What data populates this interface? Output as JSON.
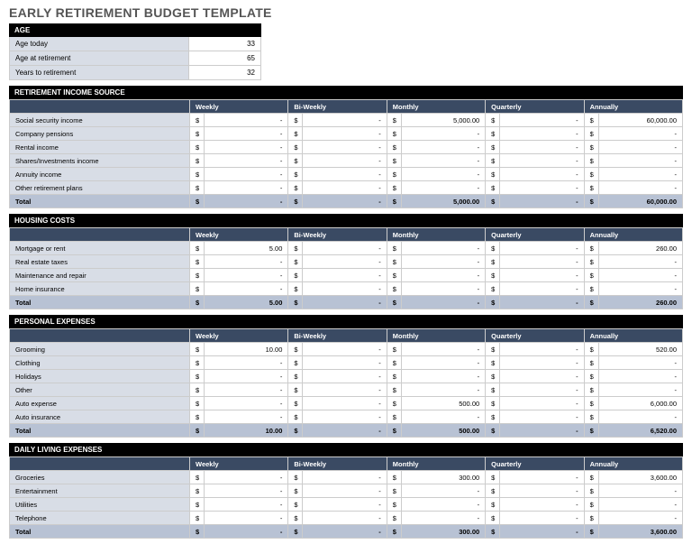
{
  "title": "EARLY RETIREMENT BUDGET TEMPLATE",
  "currency": "$",
  "dash": "-",
  "age": {
    "header": "AGE",
    "rows": [
      {
        "label": "Age today",
        "value": "33"
      },
      {
        "label": "Age at retirement",
        "value": "65"
      },
      {
        "label": "Years to retirement",
        "value": "32"
      }
    ]
  },
  "columns": [
    "Weekly",
    "Bi-Weekly",
    "Monthly",
    "Quarterly",
    "Annually"
  ],
  "totalLabel": "Total",
  "sections": [
    {
      "title": "RETIREMENT INCOME SOURCE",
      "rows": [
        {
          "label": "Social security income",
          "values": [
            "-",
            "-",
            "5,000.00",
            "-",
            "60,000.00"
          ]
        },
        {
          "label": "Company pensions",
          "values": [
            "-",
            "-",
            "-",
            "-",
            "-"
          ]
        },
        {
          "label": "Rental income",
          "values": [
            "-",
            "-",
            "-",
            "-",
            "-"
          ]
        },
        {
          "label": "Shares/Investments income",
          "values": [
            "-",
            "-",
            "-",
            "-",
            "-"
          ]
        },
        {
          "label": "Annuity income",
          "values": [
            "-",
            "-",
            "-",
            "-",
            "-"
          ]
        },
        {
          "label": "Other retirement plans",
          "values": [
            "-",
            "-",
            "-",
            "-",
            "-"
          ]
        }
      ],
      "total": [
        "-",
        "-",
        "5,000.00",
        "-",
        "60,000.00"
      ]
    },
    {
      "title": "HOUSING COSTS",
      "rows": [
        {
          "label": "Mortgage or rent",
          "values": [
            "5.00",
            "-",
            "-",
            "-",
            "260.00"
          ]
        },
        {
          "label": "Real estate taxes",
          "values": [
            "-",
            "-",
            "-",
            "-",
            "-"
          ]
        },
        {
          "label": "Maintenance and repair",
          "values": [
            "-",
            "-",
            "-",
            "-",
            "-"
          ]
        },
        {
          "label": "Home insurance",
          "values": [
            "-",
            "-",
            "-",
            "-",
            "-"
          ]
        }
      ],
      "total": [
        "5.00",
        "-",
        "-",
        "-",
        "260.00"
      ]
    },
    {
      "title": "PERSONAL EXPENSES",
      "rows": [
        {
          "label": "Grooming",
          "values": [
            "10.00",
            "-",
            "-",
            "-",
            "520.00"
          ]
        },
        {
          "label": "Clothing",
          "values": [
            "-",
            "-",
            "-",
            "-",
            "-"
          ]
        },
        {
          "label": "Holidays",
          "values": [
            "-",
            "-",
            "-",
            "-",
            "-"
          ]
        },
        {
          "label": "Other",
          "values": [
            "-",
            "-",
            "-",
            "-",
            "-"
          ]
        },
        {
          "label": "Auto expense",
          "values": [
            "-",
            "-",
            "500.00",
            "-",
            "6,000.00"
          ]
        },
        {
          "label": "Auto insurance",
          "values": [
            "-",
            "-",
            "-",
            "-",
            "-"
          ]
        }
      ],
      "total": [
        "10.00",
        "-",
        "500.00",
        "-",
        "6,520.00"
      ]
    },
    {
      "title": "DAILY LIVING EXPENSES",
      "rows": [
        {
          "label": "Groceries",
          "values": [
            "-",
            "-",
            "300.00",
            "-",
            "3,600.00"
          ]
        },
        {
          "label": "Entertainment",
          "values": [
            "-",
            "-",
            "-",
            "-",
            "-"
          ]
        },
        {
          "label": "Utilities",
          "values": [
            "-",
            "-",
            "-",
            "-",
            "-"
          ]
        },
        {
          "label": "Telephone",
          "values": [
            "-",
            "-",
            "-",
            "-",
            "-"
          ]
        }
      ],
      "total": [
        "-",
        "-",
        "300.00",
        "-",
        "3,600.00"
      ]
    }
  ]
}
